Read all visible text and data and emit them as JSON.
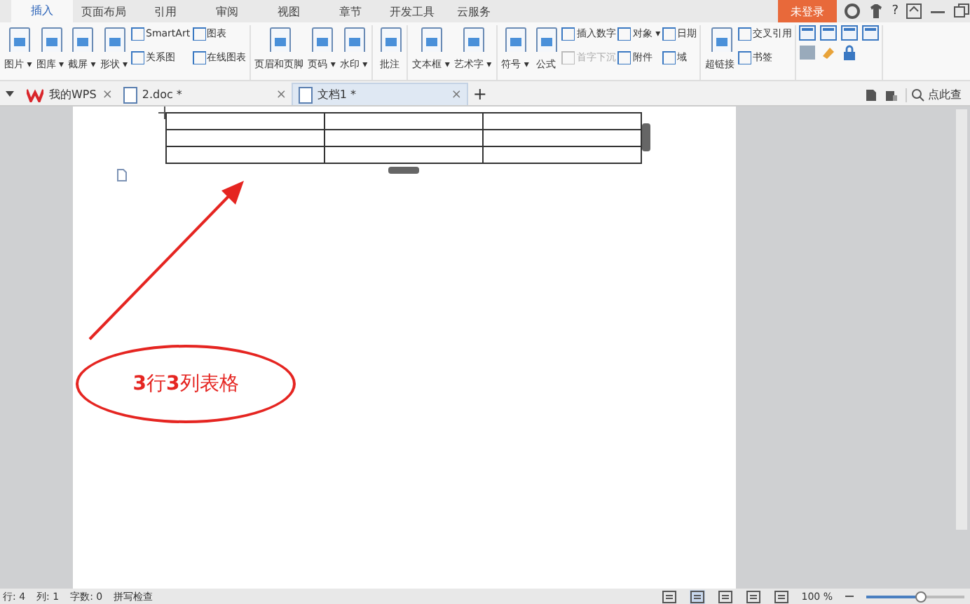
{
  "menu_tabs": [
    {
      "label": "插入",
      "selected": true
    },
    {
      "label": "页面布局",
      "selected": false
    },
    {
      "label": "引用",
      "selected": false
    },
    {
      "label": "审阅",
      "selected": false
    },
    {
      "label": "视图",
      "selected": false
    },
    {
      "label": "章节",
      "selected": false
    },
    {
      "label": "开发工具",
      "selected": false
    },
    {
      "label": "云服务",
      "selected": false
    }
  ],
  "login_button": "未登录",
  "help_label": "?",
  "ribbon": {
    "groups": [
      {
        "items": [
          {
            "kind": "big",
            "label": "图片 ▾"
          },
          {
            "kind": "big",
            "label": "图库 ▾"
          },
          {
            "kind": "big",
            "label": "截屏 ▾"
          },
          {
            "kind": "big",
            "label": "形状 ▾"
          },
          {
            "kind": "stack",
            "items": [
              {
                "label": "SmartArt",
                "disabled": false
              },
              {
                "label": "关系图",
                "disabled": false
              }
            ]
          },
          {
            "kind": "stack",
            "items": [
              {
                "label": "图表",
                "disabled": false
              },
              {
                "label": "在线图表",
                "disabled": false
              }
            ]
          }
        ]
      },
      {
        "items": [
          {
            "kind": "big",
            "label": "页眉和页脚"
          },
          {
            "kind": "big",
            "label": "页码 ▾"
          },
          {
            "kind": "big",
            "label": "水印 ▾"
          }
        ]
      },
      {
        "items": [
          {
            "kind": "big",
            "label": "批注"
          }
        ]
      },
      {
        "items": [
          {
            "kind": "big",
            "label": "文本框 ▾"
          },
          {
            "kind": "big",
            "label": "艺术字 ▾"
          }
        ]
      },
      {
        "items": [
          {
            "kind": "big",
            "label": "符号 ▾"
          },
          {
            "kind": "big",
            "label": "公式"
          },
          {
            "kind": "stack",
            "items": [
              {
                "label": "插入数字",
                "disabled": false
              },
              {
                "label": "首字下沉",
                "disabled": true
              }
            ]
          },
          {
            "kind": "stack",
            "items": [
              {
                "label": "对象 ▾",
                "disabled": false
              },
              {
                "label": "附件",
                "disabled": false
              }
            ]
          },
          {
            "kind": "stack",
            "items": [
              {
                "label": "日期",
                "disabled": false
              },
              {
                "label": "域",
                "disabled": false
              }
            ]
          }
        ]
      },
      {
        "items": [
          {
            "kind": "big",
            "label": "超链接"
          },
          {
            "kind": "stack",
            "items": [
              {
                "label": "交叉引用",
                "disabled": false
              },
              {
                "label": "书签",
                "disabled": false
              }
            ]
          }
        ]
      }
    ]
  },
  "doc_tabs": [
    {
      "label": "我的WPS",
      "selected": false,
      "close": "×"
    },
    {
      "label": "2.doc *",
      "selected": false,
      "close": "×"
    },
    {
      "label": "文档1 *",
      "selected": true,
      "close": "×"
    }
  ],
  "new_tab": "+",
  "search": {
    "placeholder": "点此查"
  },
  "annotation": {
    "text": "**3**行**3**列表格"
  },
  "status_bar": {
    "items": [
      "行: 4",
      "列: 1",
      "字数: 0"
    ],
    "spell_check": "拼写检查",
    "zoom": "100 %",
    "zoom_slider": {
      "level": 0.55
    }
  }
}
